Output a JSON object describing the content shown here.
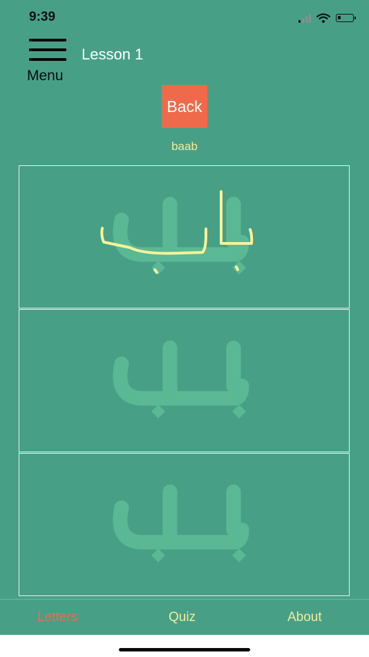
{
  "status_bar": {
    "time": "9:39",
    "battery_level": 0.2
  },
  "header": {
    "menu_label": "Menu",
    "title": "Lesson 1"
  },
  "back_label": "Back",
  "word": {
    "transliteration": "baab",
    "arabic": "باب"
  },
  "panels": [
    {
      "has_tracing": true
    },
    {
      "has_tracing": false
    },
    {
      "has_tracing": false
    }
  ],
  "tabbar": {
    "items": [
      {
        "label": "Letters",
        "active": true
      },
      {
        "label": "Quiz",
        "active": false
      },
      {
        "label": "About",
        "active": false
      }
    ]
  },
  "colors": {
    "background": "#47a086",
    "guide_letter": "#5bb894",
    "tracing_stroke": "#f7f29a",
    "accent": "#ef6a4b",
    "text_light": "#f5eb9a"
  }
}
